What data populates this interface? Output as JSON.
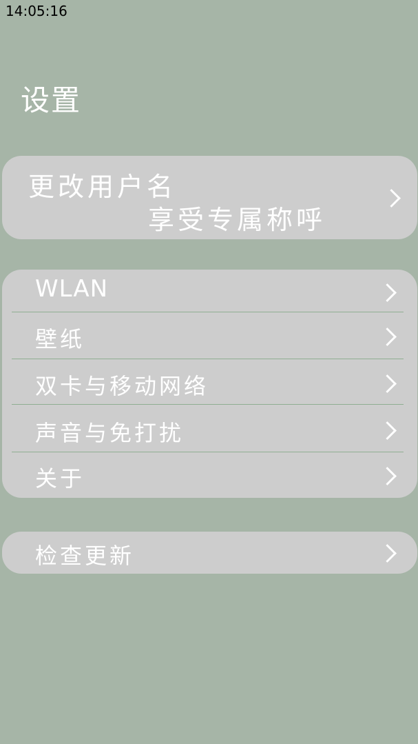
{
  "status_bar": {
    "time": "14:05:16"
  },
  "header": {
    "title": "设置"
  },
  "user_card": {
    "title": "更改用户名",
    "subtitle": "享受专属称呼",
    "icon": "chevron-right-icon"
  },
  "settings_list": {
    "items": [
      {
        "label": "WLAN",
        "icon": "chevron-right-icon"
      },
      {
        "label": "壁纸",
        "icon": "chevron-right-icon"
      },
      {
        "label": "双卡与移动网络",
        "icon": "chevron-right-icon"
      },
      {
        "label": "声音与免打扰",
        "icon": "chevron-right-icon"
      },
      {
        "label": "关于",
        "icon": "chevron-right-icon"
      }
    ]
  },
  "update_card": {
    "label": "检查更新",
    "icon": "chevron-right-icon"
  },
  "colors": {
    "background": "#a6b5a7",
    "card": "#cdcdcd",
    "divider": "#8fae92",
    "text": "#ffffff"
  }
}
